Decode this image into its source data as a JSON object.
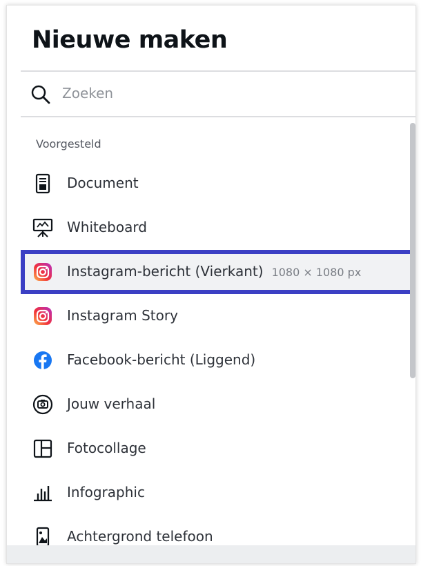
{
  "panel": {
    "title": "Nieuwe maken"
  },
  "search": {
    "placeholder": "Zoeken",
    "icon": "search-icon"
  },
  "section": {
    "label": "Voorgesteld"
  },
  "items": [
    {
      "label": "Document",
      "icon": "document-icon",
      "dims": ""
    },
    {
      "label": "Whiteboard",
      "icon": "whiteboard-icon",
      "dims": ""
    },
    {
      "label": "Instagram-bericht (Vierkant)",
      "icon": "instagram-icon",
      "dims": "1080 × 1080 px",
      "selected": true
    },
    {
      "label": "Instagram Story",
      "icon": "instagram-icon",
      "dims": ""
    },
    {
      "label": "Facebook-bericht (Liggend)",
      "icon": "facebook-icon",
      "dims": ""
    },
    {
      "label": "Jouw verhaal",
      "icon": "camera-icon",
      "dims": ""
    },
    {
      "label": "Fotocollage",
      "icon": "collage-icon",
      "dims": ""
    },
    {
      "label": "Infographic",
      "icon": "bar-chart-icon",
      "dims": ""
    },
    {
      "label": "Achtergrond telefoon",
      "icon": "phone-wallpaper-icon",
      "dims": ""
    }
  ],
  "colors": {
    "selection_outline": "#3b3fc4",
    "facebook_blue": "#1877f2",
    "text": "#2d3138"
  }
}
